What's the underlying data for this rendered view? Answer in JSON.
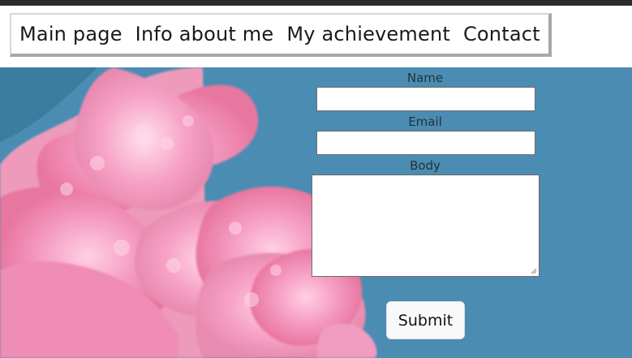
{
  "nav": {
    "items": [
      "Main page",
      "Info about me",
      "My achievement",
      "Contact"
    ]
  },
  "form": {
    "name_label": "Name",
    "email_label": "Email",
    "body_label": "Body",
    "submit_label": "Submit"
  },
  "colors": {
    "background_sky": "#4a8cb2",
    "flowers": "#f28cb6",
    "nav_border": "#a7a7a7"
  },
  "icons": {
    "resize": "textarea-resize-grip-icon"
  }
}
